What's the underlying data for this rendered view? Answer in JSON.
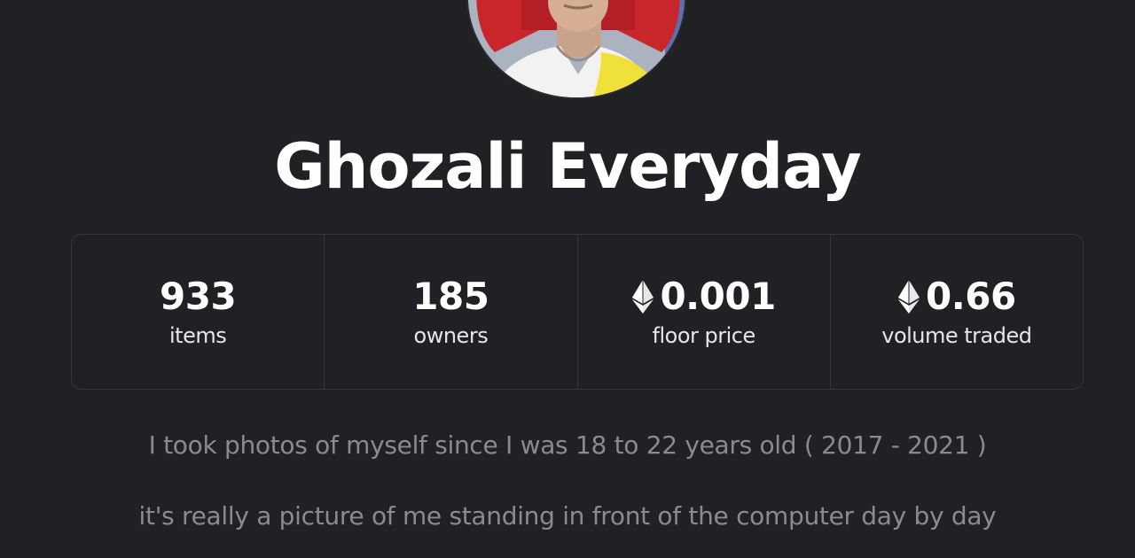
{
  "collection": {
    "title": "Ghozali Everyday",
    "description": [
      "I took photos of myself since I was 18 to 22 years old ( 2017 - 2021 )",
      "it's really a picture of me standing in front of the computer day by day"
    ]
  },
  "stats": [
    {
      "value": "933",
      "label": "items",
      "icon": ""
    },
    {
      "value": "185",
      "label": "owners",
      "icon": ""
    },
    {
      "value": "0.001",
      "label": "floor price",
      "icon": "ethereum-icon"
    },
    {
      "value": "0.66",
      "label": "volume traded",
      "icon": "ethereum-icon"
    }
  ],
  "colors": {
    "background": "#202124",
    "title": "#ffffff",
    "stat_border": "#35363a",
    "description": "#8a8b90"
  }
}
